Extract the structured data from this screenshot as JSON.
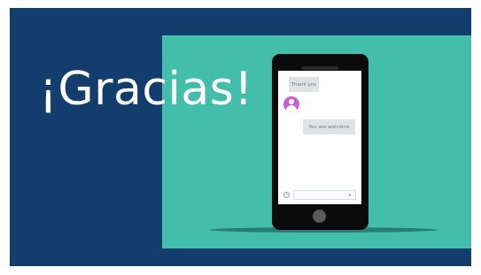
{
  "slide": {
    "title": "¡Gracias!",
    "colors": {
      "background": "#133d6c",
      "panel": "#43beab",
      "title_text": "#ffffff",
      "avatar": "#c85fd4"
    }
  },
  "chat": {
    "messages": [
      {
        "text": "Thank you",
        "side": "left"
      },
      {
        "text": "You are welcome",
        "side": "right"
      }
    ],
    "input_placeholder": "",
    "icons": [
      "user-avatar-icon",
      "add-icon",
      "send-icon"
    ]
  }
}
